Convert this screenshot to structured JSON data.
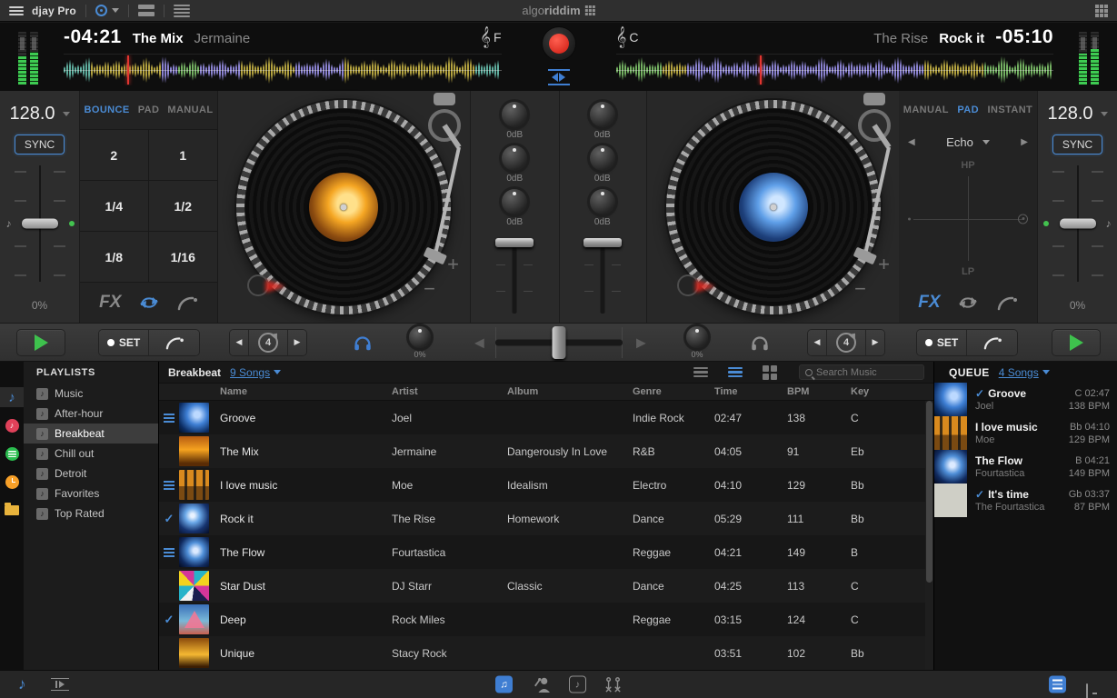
{
  "menubar": {
    "app_title": "djay Pro",
    "logo_light": "algo",
    "logo_bold": "riddim"
  },
  "decks": {
    "left": {
      "remaining_time": "-04:21",
      "title": "The Mix",
      "artist": "Jermaine",
      "key": "F",
      "bpm": "128.0",
      "sync_label": "SYNC",
      "pitch_percent": "0%",
      "tabs": [
        "BOUNCE",
        "PAD",
        "MANUAL"
      ],
      "active_tab": "BOUNCE",
      "bounce_values": [
        "2",
        "1",
        "1/4",
        "1/2",
        "1/8",
        "1/16"
      ],
      "fx_label": "FX",
      "set_label": "SET",
      "loop_beats": "4"
    },
    "right": {
      "remaining_time": "-05:10",
      "title": "Rock it",
      "artist": "The Rise",
      "key": "C",
      "bpm": "128.0",
      "sync_label": "SYNC",
      "pitch_percent": "0%",
      "tabs": [
        "MANUAL",
        "PAD",
        "INSTANT"
      ],
      "active_tab": "PAD",
      "fx_selected": "Echo",
      "xy_pad_top": "HP",
      "xy_pad_bottom": "LP",
      "fx_label": "FX",
      "set_label": "SET",
      "loop_beats": "4"
    }
  },
  "mixer": {
    "channels": [
      {
        "eq": [
          "0dB",
          "0dB",
          "0dB"
        ]
      },
      {
        "eq": [
          "0dB",
          "0dB",
          "0dB"
        ]
      }
    ],
    "filter_left": "0%",
    "filter_right": "0%"
  },
  "waveforms": {
    "palette": {
      "yellow": "#b3a23f",
      "purple": "#8a82d0",
      "green": "#74b162",
      "teal": "#5fae9e"
    },
    "left": {
      "playhead": 0.145,
      "segments": [
        [
          "teal",
          0.06
        ],
        [
          "yellow",
          0.09
        ],
        [
          "yellow",
          0.07
        ],
        [
          "purple",
          0.04
        ],
        [
          "green",
          0.05
        ],
        [
          "purple",
          0.09
        ],
        [
          "yellow",
          0.07
        ],
        [
          "yellow",
          0.06
        ],
        [
          "purple",
          0.11
        ],
        [
          "yellow",
          0.13
        ],
        [
          "yellow",
          0.09
        ],
        [
          "yellow",
          0.08
        ],
        [
          "teal",
          0.06
        ]
      ]
    },
    "right": {
      "playhead": 0.33,
      "segments": [
        [
          "green",
          0.1
        ],
        [
          "yellow",
          0.06
        ],
        [
          "purple",
          0.16
        ],
        [
          "purple",
          0.22
        ],
        [
          "purple",
          0.16
        ],
        [
          "yellow",
          0.14
        ],
        [
          "green",
          0.16
        ]
      ]
    }
  },
  "library": {
    "sidebar": {
      "header": "PLAYLISTS",
      "items": [
        "Music",
        "After-hour",
        "Breakbeat",
        "Chill out",
        "Detroit",
        "Favorites",
        "Top Rated"
      ],
      "selected_index": 2
    },
    "toolbar": {
      "playlist_name": "Breakbeat",
      "songs_link": "9 Songs",
      "search_placeholder": "Search Music"
    },
    "table": {
      "columns": [
        "Name",
        "Artist",
        "Album",
        "Genre",
        "Time",
        "BPM",
        "Key"
      ],
      "rows": [
        {
          "marker": "queue",
          "art": "groove",
          "name": "Groove",
          "artist": "Joel",
          "album": "",
          "genre": "Indie Rock",
          "time": "02:47",
          "bpm": "138",
          "key": "C"
        },
        {
          "marker": "",
          "art": "mix",
          "name": "The Mix",
          "artist": "Jermaine",
          "album": "Dangerously In Love",
          "genre": "R&B",
          "time": "04:05",
          "bpm": "91",
          "key": "Eb"
        },
        {
          "marker": "queue",
          "art": "palms",
          "name": "I love music",
          "artist": "Moe",
          "album": "Idealism",
          "genre": "Electro",
          "time": "04:10",
          "bpm": "129",
          "key": "Bb"
        },
        {
          "marker": "check",
          "art": "splash",
          "name": "Rock it",
          "artist": "The Rise",
          "album": "Homework",
          "genre": "Dance",
          "time": "05:29",
          "bpm": "111",
          "key": "Bb"
        },
        {
          "marker": "queue",
          "art": "splash2",
          "name": "The Flow",
          "artist": "Fourtastica",
          "album": "",
          "genre": "Reggae",
          "time": "04:21",
          "bpm": "149",
          "key": "B"
        },
        {
          "marker": "",
          "art": "mosaic",
          "name": "Star Dust",
          "artist": "DJ Starr",
          "album": "Classic",
          "genre": "Dance",
          "time": "04:25",
          "bpm": "113",
          "key": "C"
        },
        {
          "marker": "check",
          "art": "pyramid",
          "name": "Deep",
          "artist": "Rock Miles",
          "album": "",
          "genre": "Reggae",
          "time": "03:15",
          "bpm": "124",
          "key": "C"
        },
        {
          "marker": "",
          "art": "crowd",
          "name": "Unique",
          "artist": "Stacy Rock",
          "album": "",
          "genre": "",
          "time": "03:51",
          "bpm": "102",
          "key": "Bb"
        }
      ]
    },
    "queue": {
      "header": "QUEUE",
      "songs_link": "4 Songs",
      "items": [
        {
          "checked": true,
          "art": "groove",
          "title": "Groove",
          "artist": "Joel",
          "key_time": "C 02:47",
          "bpm": "138 BPM"
        },
        {
          "checked": false,
          "art": "palms",
          "title": "I love music",
          "artist": "Moe",
          "key_time": "Bb 04:10",
          "bpm": "129 BPM"
        },
        {
          "checked": false,
          "art": "splash2",
          "title": "The Flow",
          "artist": "Fourtastica",
          "key_time": "B 04:21",
          "bpm": "149 BPM"
        },
        {
          "checked": true,
          "art": "circles",
          "title": "It's time",
          "artist": "The Fourtastica",
          "key_time": "Gb 03:37",
          "bpm": "87 BPM"
        }
      ]
    }
  }
}
